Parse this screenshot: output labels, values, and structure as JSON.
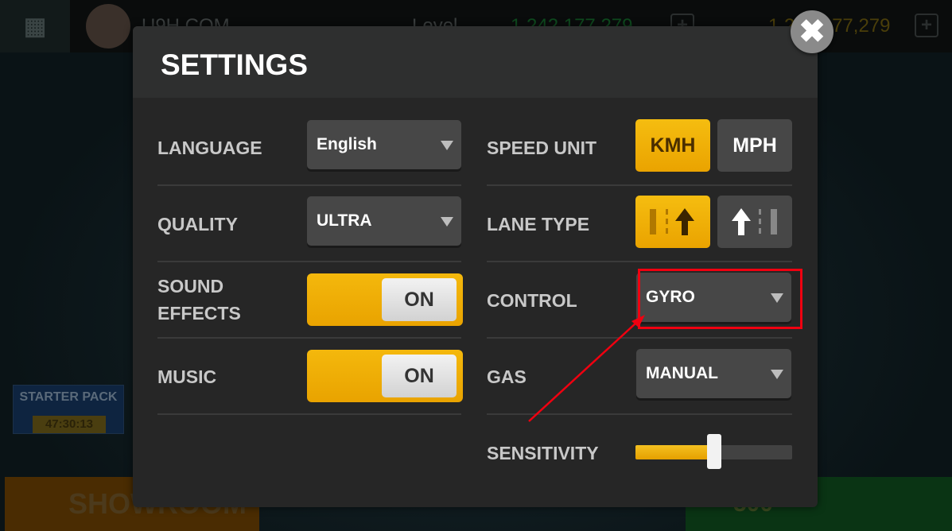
{
  "background": {
    "username": "U9H.COM",
    "level_label": "Level",
    "cash": "1,242,177,279",
    "gold": "1,242,177,279",
    "starter_pack": {
      "title": "STARTER PACK",
      "timer": "47:30:13"
    },
    "showroom_label": "SHOWROOM",
    "reward_amount": "500"
  },
  "settings": {
    "title": "SETTINGS",
    "left": [
      {
        "label": "LANGUAGE",
        "type": "dropdown",
        "value": "English"
      },
      {
        "label": "QUALITY",
        "type": "dropdown",
        "value": "ULTRA"
      },
      {
        "label": "SOUND\nEFFECTS",
        "type": "toggle",
        "value": "ON"
      },
      {
        "label": "MUSIC",
        "type": "toggle",
        "value": "ON"
      }
    ],
    "right": [
      {
        "label": "SPEED UNIT",
        "type": "segmented",
        "options": [
          "KMH",
          "MPH"
        ],
        "selected": "KMH"
      },
      {
        "label": "LANE TYPE",
        "type": "segmented",
        "options": [
          "lane-right-icon",
          "lane-left-icon"
        ],
        "selected": "lane-right-icon"
      },
      {
        "label": "CONTROL",
        "type": "dropdown",
        "value": "GYRO"
      },
      {
        "label": "GAS",
        "type": "dropdown",
        "value": "MANUAL"
      },
      {
        "label": "SENSITIVITY",
        "type": "slider",
        "value_fraction": 0.5
      }
    ]
  },
  "annotation": {
    "highlight_color": "#f00010",
    "target": "CONTROL dropdown"
  },
  "colors": {
    "accent": "#f4b80c",
    "panel": "#262626",
    "control": "#474747"
  }
}
